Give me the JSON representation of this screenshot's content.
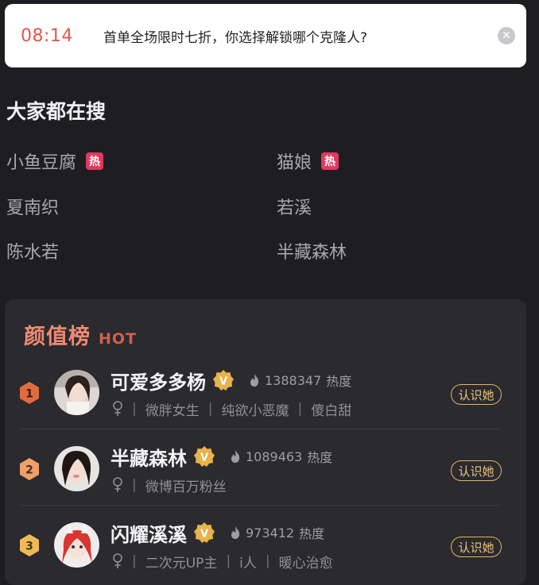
{
  "banner": {
    "time": "08:14",
    "text": "首单全场限时七折，你选择解锁哪个克隆人?"
  },
  "search": {
    "title": "大家都在搜",
    "items": [
      {
        "label": "小鱼豆腐",
        "hot": true
      },
      {
        "label": "猫娘",
        "hot": true
      },
      {
        "label": "夏南织",
        "hot": false
      },
      {
        "label": "若溪",
        "hot": false
      },
      {
        "label": "陈水若",
        "hot": false
      },
      {
        "label": "半藏森林",
        "hot": false
      }
    ],
    "hot_tag": "热"
  },
  "ranking": {
    "title": "颜值榜",
    "hot_label": "HOT",
    "rows": [
      {
        "rank": "1",
        "name": "可爱多多杨",
        "heat": "1388347",
        "heat_label": "热度",
        "tags": [
          "微胖女生",
          "纯欲小恶魔",
          "傻白甜"
        ],
        "button": "认识她"
      },
      {
        "rank": "2",
        "name": "半藏森林",
        "heat": "1089463",
        "heat_label": "热度",
        "tags": [
          "微博百万粉丝"
        ],
        "button": "认识她"
      },
      {
        "rank": "3",
        "name": "闪耀溪溪",
        "heat": "973412",
        "heat_label": "热度",
        "tags": [
          "二次元UP主",
          "i人",
          "暖心治愈"
        ],
        "button": "认识她"
      }
    ]
  },
  "colors": {
    "accent_time": "#e4574b",
    "hot_tag": "#e2395c",
    "rank1": "#e06b3f",
    "rank2": "#eda06a",
    "rank3": "#f0b955",
    "button_border": "#e6b55c"
  }
}
